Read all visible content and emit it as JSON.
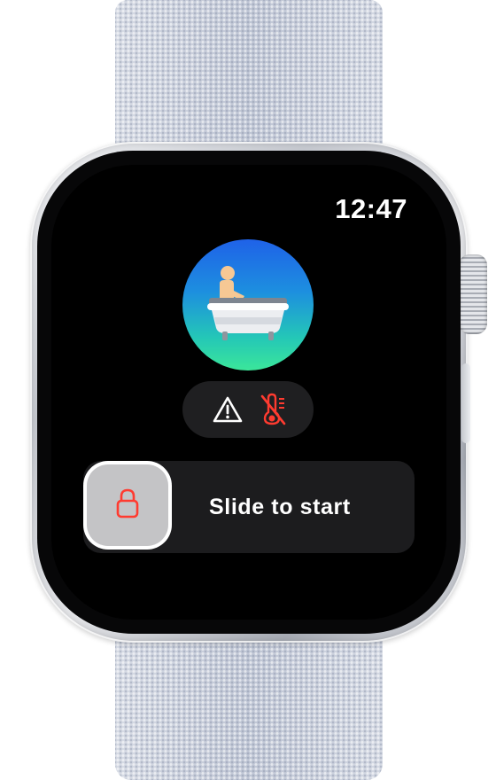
{
  "status_bar": {
    "time": "12:47"
  },
  "app": {
    "icon": "bathtub-icon",
    "icon_colors": [
      "#1f62e8",
      "#3be69a"
    ]
  },
  "status_indicators": [
    {
      "icon": "warning-triangle-icon",
      "color": "#ffffff"
    },
    {
      "icon": "thermometer-off-icon",
      "color": "#ff3b30"
    }
  ],
  "slider": {
    "label": "Slide to start",
    "thumb_icon": "lock-icon",
    "thumb_icon_color": "#ff3b30"
  }
}
